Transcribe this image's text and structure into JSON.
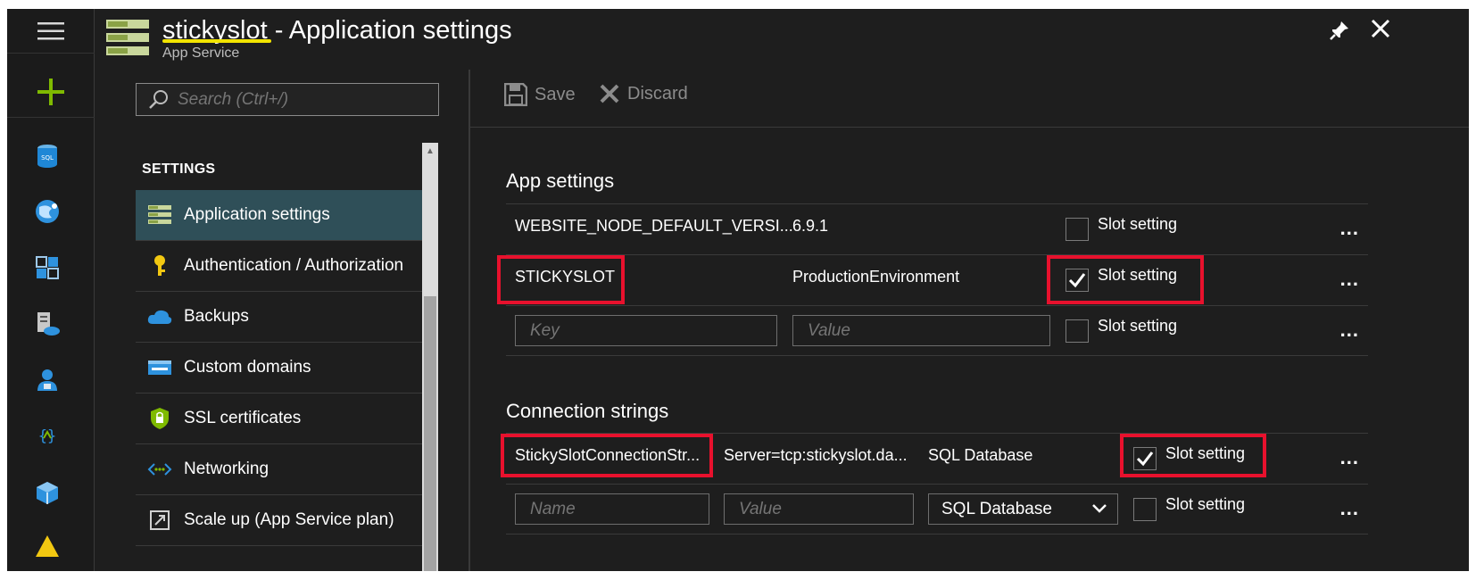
{
  "window": {
    "resource_name": "stickyslot",
    "title_suffix": " - Application settings",
    "subtitle": "App Service"
  },
  "rail": {
    "icons": [
      "menu-icon",
      "plus-icon",
      "sql-database-icon",
      "globe-icon",
      "virtual-machine-icon",
      "app-service-icon",
      "user-icon",
      "api-icon",
      "cube-icon"
    ]
  },
  "menu": {
    "search_placeholder": "Search (Ctrl+/)",
    "heading": "SETTINGS",
    "items": [
      {
        "label": "Application settings",
        "icon": "settings-list-icon",
        "active": true
      },
      {
        "label": "Authentication / Authorization",
        "icon": "key-icon",
        "active": false
      },
      {
        "label": "Backups",
        "icon": "cloud-icon",
        "active": false
      },
      {
        "label": "Custom domains",
        "icon": "domain-icon",
        "active": false
      },
      {
        "label": "SSL certificates",
        "icon": "shield-icon",
        "active": false
      },
      {
        "label": "Networking",
        "icon": "network-icon",
        "active": false
      },
      {
        "label": "Scale up (App Service plan)",
        "icon": "scale-up-icon",
        "active": false
      }
    ]
  },
  "toolbar": {
    "save_label": "Save",
    "discard_label": "Discard"
  },
  "app_settings": {
    "title": "App settings",
    "rows": [
      {
        "key": "WEBSITE_NODE_DEFAULT_VERSI...",
        "value": "6.9.1",
        "slot_setting": false,
        "slot_label": "Slot setting"
      },
      {
        "key": "STICKYSLOT",
        "value": "ProductionEnvironment",
        "slot_setting": true,
        "slot_label": "Slot setting"
      }
    ],
    "new_row": {
      "key_placeholder": "Key",
      "value_placeholder": "Value",
      "slot_label": "Slot setting"
    }
  },
  "connection_strings": {
    "title": "Connection strings",
    "rows": [
      {
        "name": "StickySlotConnectionStr...",
        "value": "Server=tcp:stickyslot.da...",
        "type": "SQL Database",
        "slot_setting": true,
        "slot_label": "Slot setting"
      }
    ],
    "new_row": {
      "name_placeholder": "Name",
      "value_placeholder": "Value",
      "type_selected": "SQL Database",
      "slot_label": "Slot setting"
    }
  },
  "more_label": "...",
  "colors": {
    "background": "#1e1e1e",
    "active_item": "#2f4f58",
    "highlight": "#e8112d",
    "underline": "#f2e400",
    "accent_green": "#7fba00"
  }
}
